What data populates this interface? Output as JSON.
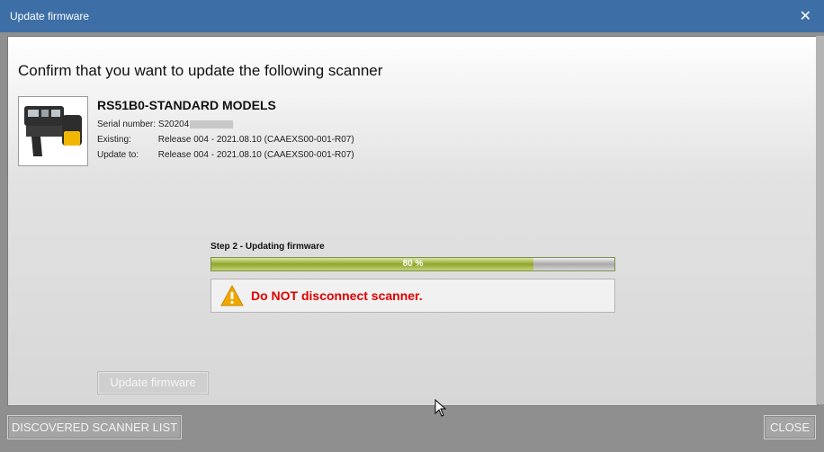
{
  "window": {
    "title": "Update firmware"
  },
  "dialog": {
    "heading": "Confirm that you want to update the following scanner",
    "scanner": {
      "model": "RS51B0-STANDARD MODELS",
      "serial_label": "Serial number:",
      "serial_value": "S20204",
      "existing_label": "Existing:",
      "existing_value": "Release 004 - 2021.08.10 (CAAEXS00-001-R07)",
      "update_label": "Update to:",
      "update_value": "Release 004 - 2021.08.10 (CAAEXS00-001-R07)"
    },
    "step_label": "Step 2 - Updating firmware",
    "progress": {
      "percent": 80,
      "label": "80 %"
    },
    "warning": "Do NOT disconnect scanner.",
    "update_button": "Update firmware"
  },
  "footer": {
    "discovered_button": "DISCOVERED SCANNER LIST",
    "close_button": "CLOSE"
  },
  "colors": {
    "titlebar": "#3d6fa6",
    "progress_fill": "#8fa62a",
    "warning_text": "#e00000",
    "warning_icon": "#f0a800"
  },
  "icons": [
    "close-icon",
    "scanner-image",
    "warning-icon",
    "mouse-cursor-icon"
  ]
}
